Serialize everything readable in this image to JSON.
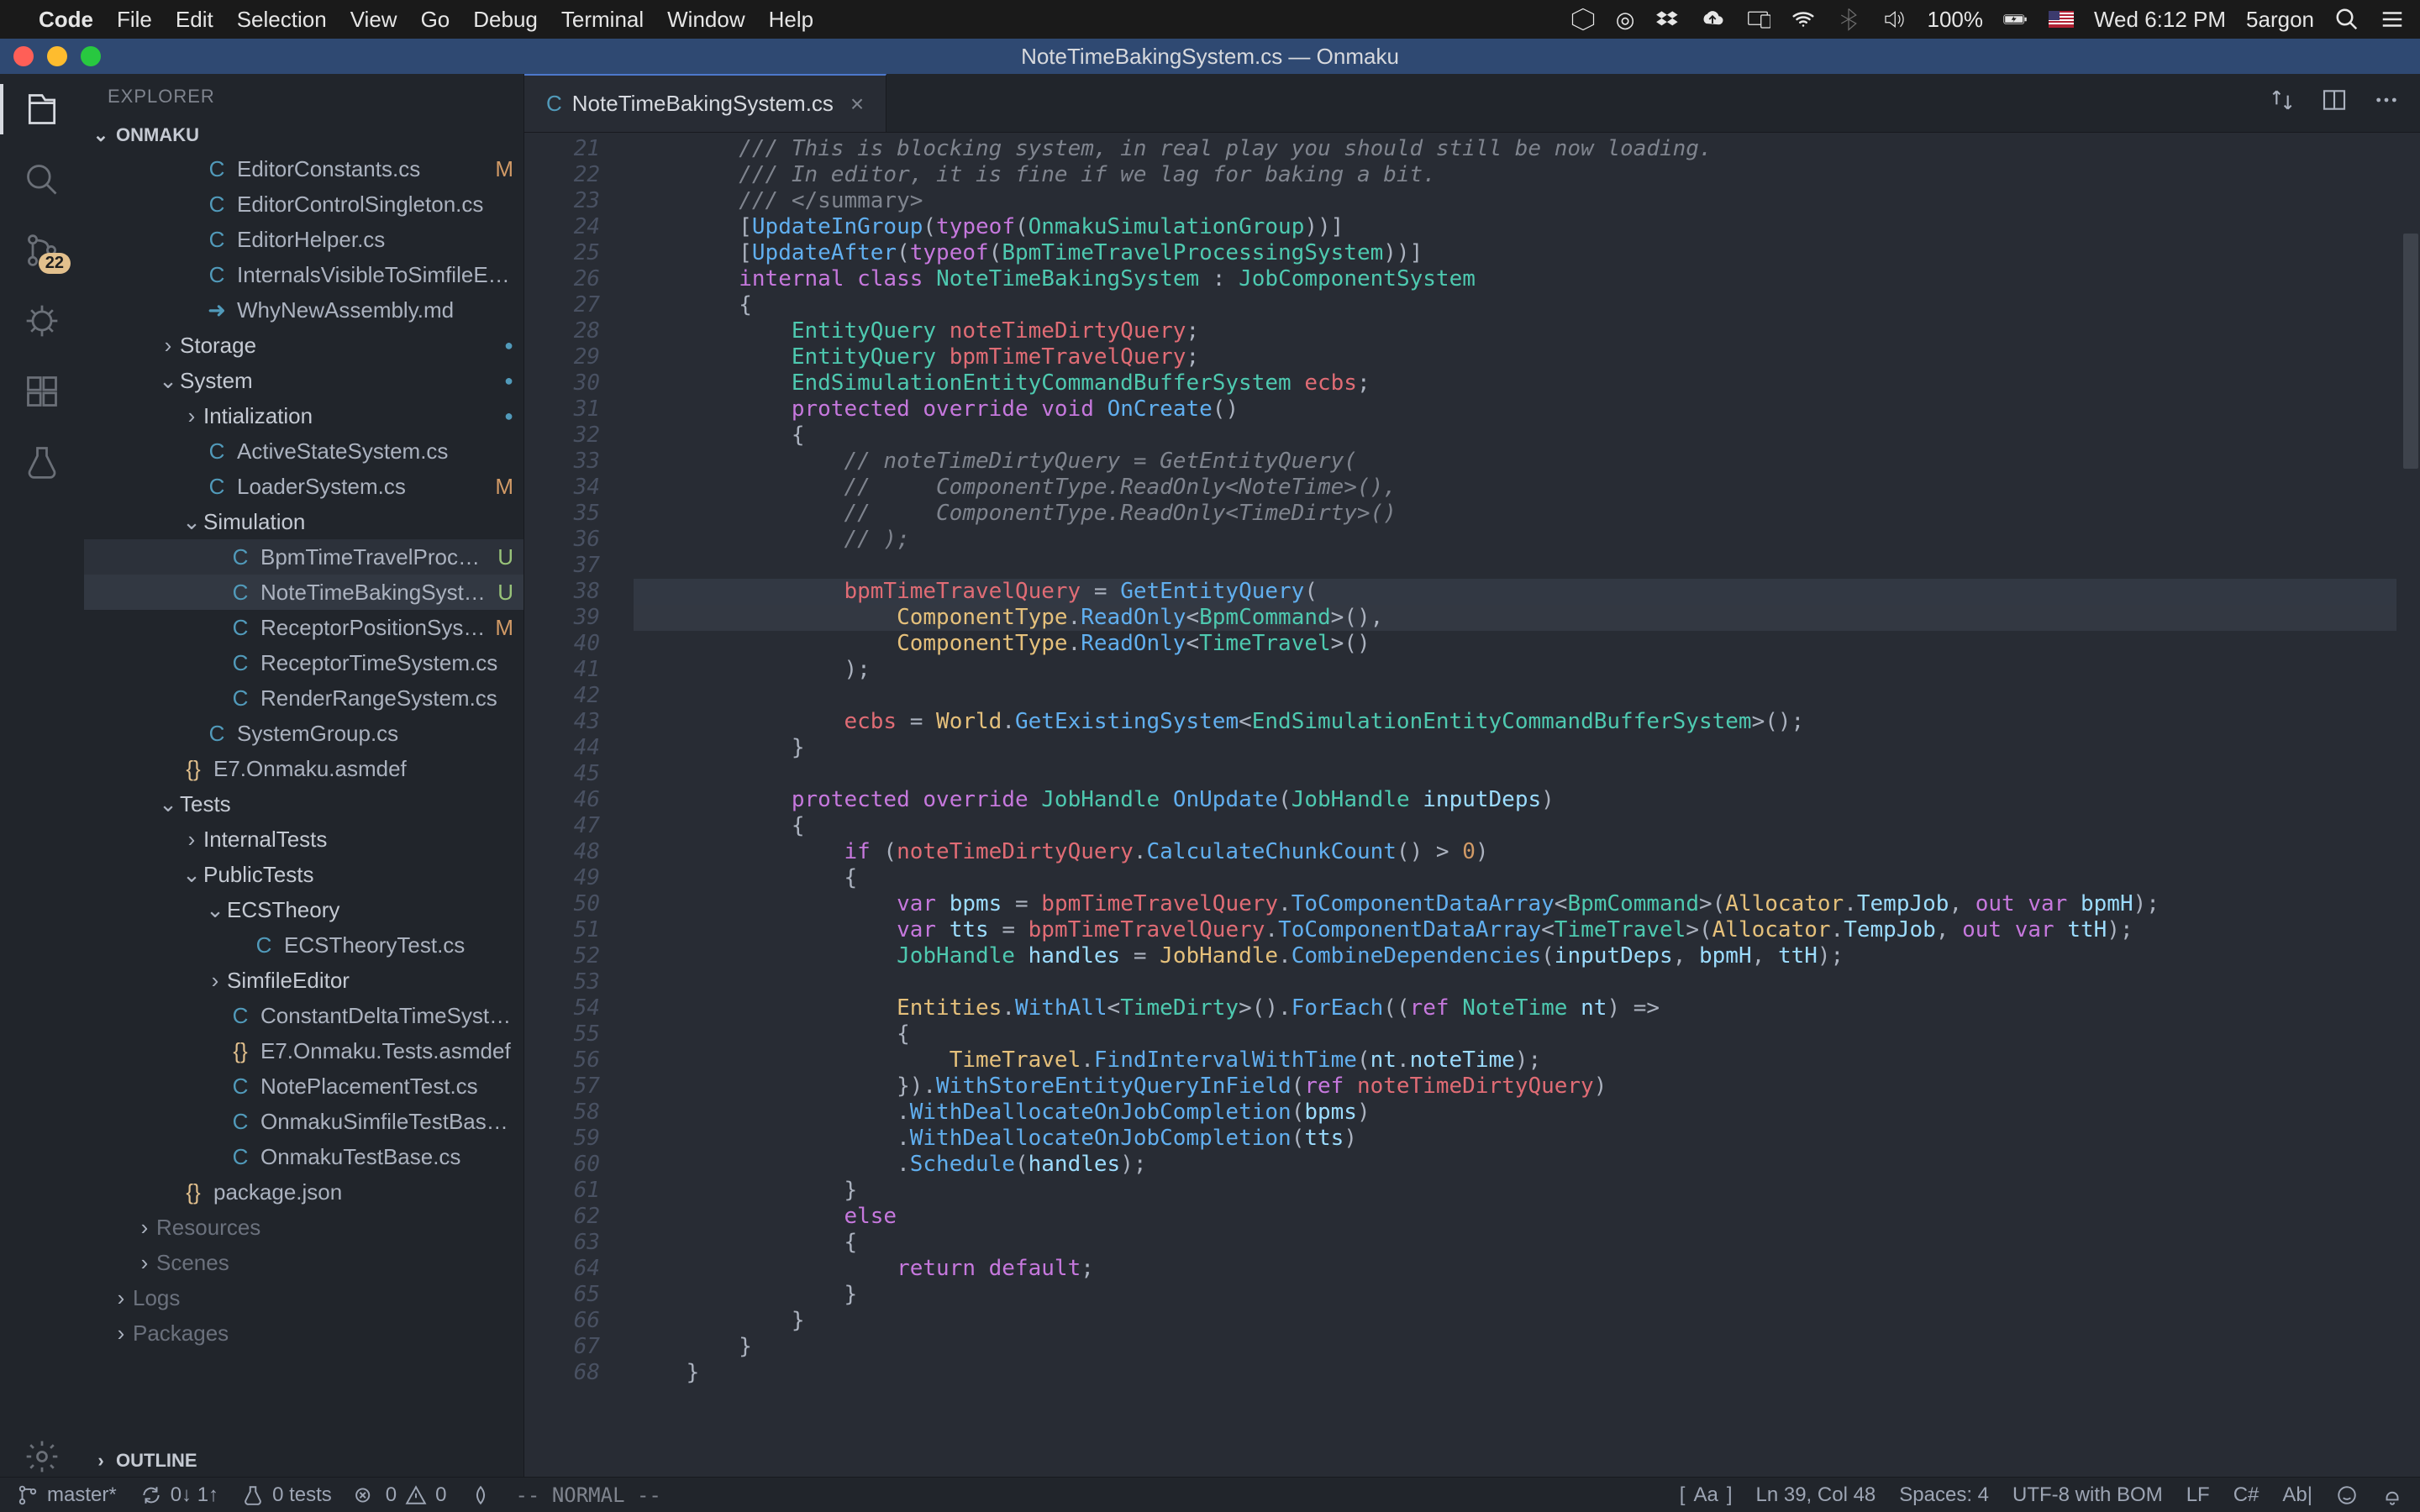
{
  "menubar": {
    "app": "Code",
    "items": [
      "File",
      "Edit",
      "Selection",
      "View",
      "Go",
      "Debug",
      "Terminal",
      "Window",
      "Help"
    ],
    "battery": "100%",
    "clock": "Wed 6:12 PM",
    "user": "5argon"
  },
  "titlebar": {
    "title": "NoteTimeBakingSystem.cs — Onmaku"
  },
  "activity": {
    "scm_badge": "22"
  },
  "sidebar": {
    "title": "EXPLORER",
    "section": "ONMAKU",
    "outline": "OUTLINE",
    "tree": [
      {
        "indent": 3,
        "icon": "cs",
        "label": "EditorConstants.cs",
        "status": "M"
      },
      {
        "indent": 3,
        "icon": "cs",
        "label": "EditorControlSingleton.cs"
      },
      {
        "indent": 3,
        "icon": "cs",
        "label": "EditorHelper.cs"
      },
      {
        "indent": 3,
        "icon": "cs",
        "label": "InternalsVisibleToSimfileEditor.cs"
      },
      {
        "indent": 3,
        "icon": "md",
        "label": "WhyNewAssembly.md"
      },
      {
        "indent": 2,
        "twisty": ">",
        "folder": true,
        "label": "Storage",
        "dot": true
      },
      {
        "indent": 2,
        "twisty": "v",
        "folder": true,
        "label": "System",
        "dot": true
      },
      {
        "indent": 3,
        "twisty": ">",
        "folder": true,
        "label": "Intialization",
        "dot": true
      },
      {
        "indent": 3,
        "icon": "cs",
        "label": "ActiveStateSystem.cs"
      },
      {
        "indent": 3,
        "icon": "cs",
        "label": "LoaderSystem.cs",
        "status": "M"
      },
      {
        "indent": 3,
        "twisty": "v",
        "folder": true,
        "label": "Simulation"
      },
      {
        "indent": 4,
        "icon": "cs",
        "label": "BpmTimeTravelProcessin...",
        "status": "U",
        "sel": true
      },
      {
        "indent": 4,
        "icon": "cs",
        "label": "NoteTimeBakingSystem.cs",
        "status": "U",
        "active": true
      },
      {
        "indent": 4,
        "icon": "cs",
        "label": "ReceptorPositionSystem.cs",
        "status": "M"
      },
      {
        "indent": 4,
        "icon": "cs",
        "label": "ReceptorTimeSystem.cs"
      },
      {
        "indent": 4,
        "icon": "cs",
        "label": "RenderRangeSystem.cs"
      },
      {
        "indent": 3,
        "icon": "cs",
        "label": "SystemGroup.cs"
      },
      {
        "indent": 2,
        "icon": "asm",
        "label": "E7.Onmaku.asmdef"
      },
      {
        "indent": 2,
        "twisty": "v",
        "folder": true,
        "label": "Tests"
      },
      {
        "indent": 3,
        "twisty": ">",
        "folder": true,
        "label": "InternalTests"
      },
      {
        "indent": 3,
        "twisty": "v",
        "folder": true,
        "label": "PublicTests"
      },
      {
        "indent": 4,
        "twisty": "v",
        "folder": true,
        "label": "ECSTheory"
      },
      {
        "indent": 5,
        "icon": "cs",
        "label": "ECSTheoryTest.cs"
      },
      {
        "indent": 4,
        "twisty": ">",
        "folder": true,
        "label": "SimfileEditor"
      },
      {
        "indent": 4,
        "icon": "cs",
        "label": "ConstantDeltaTimeSystem.cs"
      },
      {
        "indent": 4,
        "icon": "asm",
        "label": "E7.Onmaku.Tests.asmdef"
      },
      {
        "indent": 4,
        "icon": "cs",
        "label": "NotePlacementTest.cs"
      },
      {
        "indent": 4,
        "icon": "cs",
        "label": "OnmakuSimfileTestBase.cs"
      },
      {
        "indent": 4,
        "icon": "cs",
        "label": "OnmakuTestBase.cs"
      },
      {
        "indent": 2,
        "icon": "json",
        "label": "package.json"
      },
      {
        "indent": 1,
        "twisty": ">",
        "folder": true,
        "label": "Resources",
        "dim": true
      },
      {
        "indent": 1,
        "twisty": ">",
        "folder": true,
        "label": "Scenes",
        "dim": true
      },
      {
        "indent": 0,
        "twisty": ">",
        "folder": true,
        "label": "Logs",
        "dim": true
      },
      {
        "indent": 0,
        "twisty": ">",
        "folder": true,
        "label": "Packages",
        "dim": true
      }
    ]
  },
  "tab": {
    "label": "NoteTimeBakingSystem.cs"
  },
  "code": {
    "first_line": 21,
    "lines": [
      {
        "h": "        <span class='c-comment'>/// This is blocking system, in real play you should still be now loading.</span>"
      },
      {
        "h": "        <span class='c-comment'>/// In editor, it is fine if we lag for baking a bit.</span>"
      },
      {
        "h": "        <span class='c-comment'>/// </span><span class='c-tag'>&lt;/summary&gt;</span>"
      },
      {
        "h": "        [<span class='c-fn'>UpdateInGroup</span>(<span class='c-kw'>typeof</span>(<span class='c-type'>OnmakuSimulationGroup</span>))]"
      },
      {
        "h": "        [<span class='c-fn'>UpdateAfter</span>(<span class='c-kw'>typeof</span>(<span class='c-type'>BpmTimeTravelProcessingSystem</span>))]"
      },
      {
        "h": "        <span class='c-kw'>internal</span> <span class='c-kw'>class</span> <span class='c-type'>NoteTimeBakingSystem</span> : <span class='c-type'>JobComponentSystem</span>"
      },
      {
        "h": "        {"
      },
      {
        "h": "            <span class='c-type'>EntityQuery</span> <span class='c-field'>noteTimeDirtyQuery</span>;"
      },
      {
        "h": "            <span class='c-type'>EntityQuery</span> <span class='c-field'>bpmTimeTravelQuery</span>;"
      },
      {
        "h": "            <span class='c-type'>EndSimulationEntityCommandBufferSystem</span> <span class='c-field'>ecbs</span>;"
      },
      {
        "h": "            <span class='c-kw'>protected</span> <span class='c-kw'>override</span> <span class='c-kw'>void</span> <span class='c-fn'>OnCreate</span>()"
      },
      {
        "h": "            {"
      },
      {
        "h": "                <span class='c-comment'>// noteTimeDirtyQuery = GetEntityQuery(</span>"
      },
      {
        "h": "                <span class='c-comment'>//     ComponentType.ReadOnly&lt;NoteTime&gt;(),</span>"
      },
      {
        "h": "                <span class='c-comment'>//     ComponentType.ReadOnly&lt;TimeDirty&gt;()</span>"
      },
      {
        "h": "                <span class='c-comment'>// );</span>"
      },
      {
        "h": ""
      },
      {
        "h": "                <span class='c-field'>bpmTimeTravelQuery</span> = <span class='c-fn'>GetEntityQuery</span>(",
        "hl2": true
      },
      {
        "h": "                    <span class='c-var'>ComponentType</span>.<span class='c-fn'>ReadOnly</span>&lt;<span class='c-type'>BpmCommand</span>&gt;(),",
        "hl": true
      },
      {
        "h": "                    <span class='c-var'>ComponentType</span>.<span class='c-fn'>ReadOnly</span>&lt;<span class='c-type'>TimeTravel</span>&gt;()"
      },
      {
        "h": "                );"
      },
      {
        "h": ""
      },
      {
        "h": "                <span class='c-field'>ecbs</span> = <span class='c-var'>World</span>.<span class='c-fn'>GetExistingSystem</span>&lt;<span class='c-type'>EndSimulationEntityCommandBufferSystem</span>&gt;();"
      },
      {
        "h": "            }"
      },
      {
        "h": ""
      },
      {
        "h": "            <span class='c-kw'>protected</span> <span class='c-kw'>override</span> <span class='c-type'>JobHandle</span> <span class='c-fn'>OnUpdate</span>(<span class='c-type'>JobHandle</span> <span class='c-param'>inputDeps</span>)"
      },
      {
        "h": "            {"
      },
      {
        "h": "                <span class='c-kw'>if</span> (<span class='c-field'>noteTimeDirtyQuery</span>.<span class='c-fn'>CalculateChunkCount</span>() &gt; <span class='c-num'>0</span>)"
      },
      {
        "h": "                {"
      },
      {
        "h": "                    <span class='c-kw'>var</span> <span class='c-var2'>bpms</span> = <span class='c-field'>bpmTimeTravelQuery</span>.<span class='c-fn'>ToComponentDataArray</span>&lt;<span class='c-type'>BpmCommand</span>&gt;(<span class='c-var'>Allocator</span>.<span class='c-prop'>TempJob</span>, <span class='c-kw'>out</span> <span class='c-kw'>var</span> <span class='c-var2'>bpmH</span>);"
      },
      {
        "h": "                    <span class='c-kw'>var</span> <span class='c-var2'>tts</span> = <span class='c-field'>bpmTimeTravelQuery</span>.<span class='c-fn'>ToComponentDataArray</span>&lt;<span class='c-type'>TimeTravel</span>&gt;(<span class='c-var'>Allocator</span>.<span class='c-prop'>TempJob</span>, <span class='c-kw'>out</span> <span class='c-kw'>var</span> <span class='c-var2'>ttH</span>);"
      },
      {
        "h": "                    <span class='c-type'>JobHandle</span> <span class='c-var2'>handles</span> = <span class='c-var'>JobHandle</span>.<span class='c-fn'>CombineDependencies</span>(<span class='c-param'>inputDeps</span>, <span class='c-var2'>bpmH</span>, <span class='c-var2'>ttH</span>);"
      },
      {
        "h": ""
      },
      {
        "h": "                    <span class='c-var'>Entities</span>.<span class='c-fn'>WithAll</span>&lt;<span class='c-type'>TimeDirty</span>&gt;().<span class='c-fn'>ForEach</span>((<span class='c-kw'>ref</span> <span class='c-type'>NoteTime</span> <span class='c-param'>nt</span>) =&gt;"
      },
      {
        "h": "                    {"
      },
      {
        "h": "                        <span class='c-var'>TimeTravel</span>.<span class='c-fn'>FindIntervalWithTime</span>(<span class='c-param'>nt</span>.<span class='c-prop'>noteTime</span>);"
      },
      {
        "h": "                    }).<span class='c-fn'>WithStoreEntityQueryInField</span>(<span class='c-kw'>ref</span> <span class='c-field'>noteTimeDirtyQuery</span>)"
      },
      {
        "h": "                    .<span class='c-fn'>WithDeallocateOnJobCompletion</span>(<span class='c-var2'>bpms</span>)"
      },
      {
        "h": "                    .<span class='c-fn'>WithDeallocateOnJobCompletion</span>(<span class='c-var2'>tts</span>)"
      },
      {
        "h": "                    .<span class='c-fn'>Schedule</span>(<span class='c-var2'>handles</span>);"
      },
      {
        "h": "                }"
      },
      {
        "h": "                <span class='c-kw'>else</span>"
      },
      {
        "h": "                {"
      },
      {
        "h": "                    <span class='c-kw'>return</span> <span class='c-kw'>default</span>;"
      },
      {
        "h": "                }"
      },
      {
        "h": "            }"
      },
      {
        "h": "        }"
      },
      {
        "h": "    }"
      }
    ]
  },
  "status": {
    "branch": "master*",
    "sync": "0↓ 1↑",
    "tests": "0 tests",
    "errwarn": "0  0",
    "vim": "-- NORMAL --",
    "matchcase": "Aa",
    "pos": "Ln 39, Col 48",
    "spaces": "Spaces: 4",
    "enc": "UTF-8 with BOM",
    "eol": "LF",
    "lang": "C#",
    "ab": "Ab|"
  }
}
